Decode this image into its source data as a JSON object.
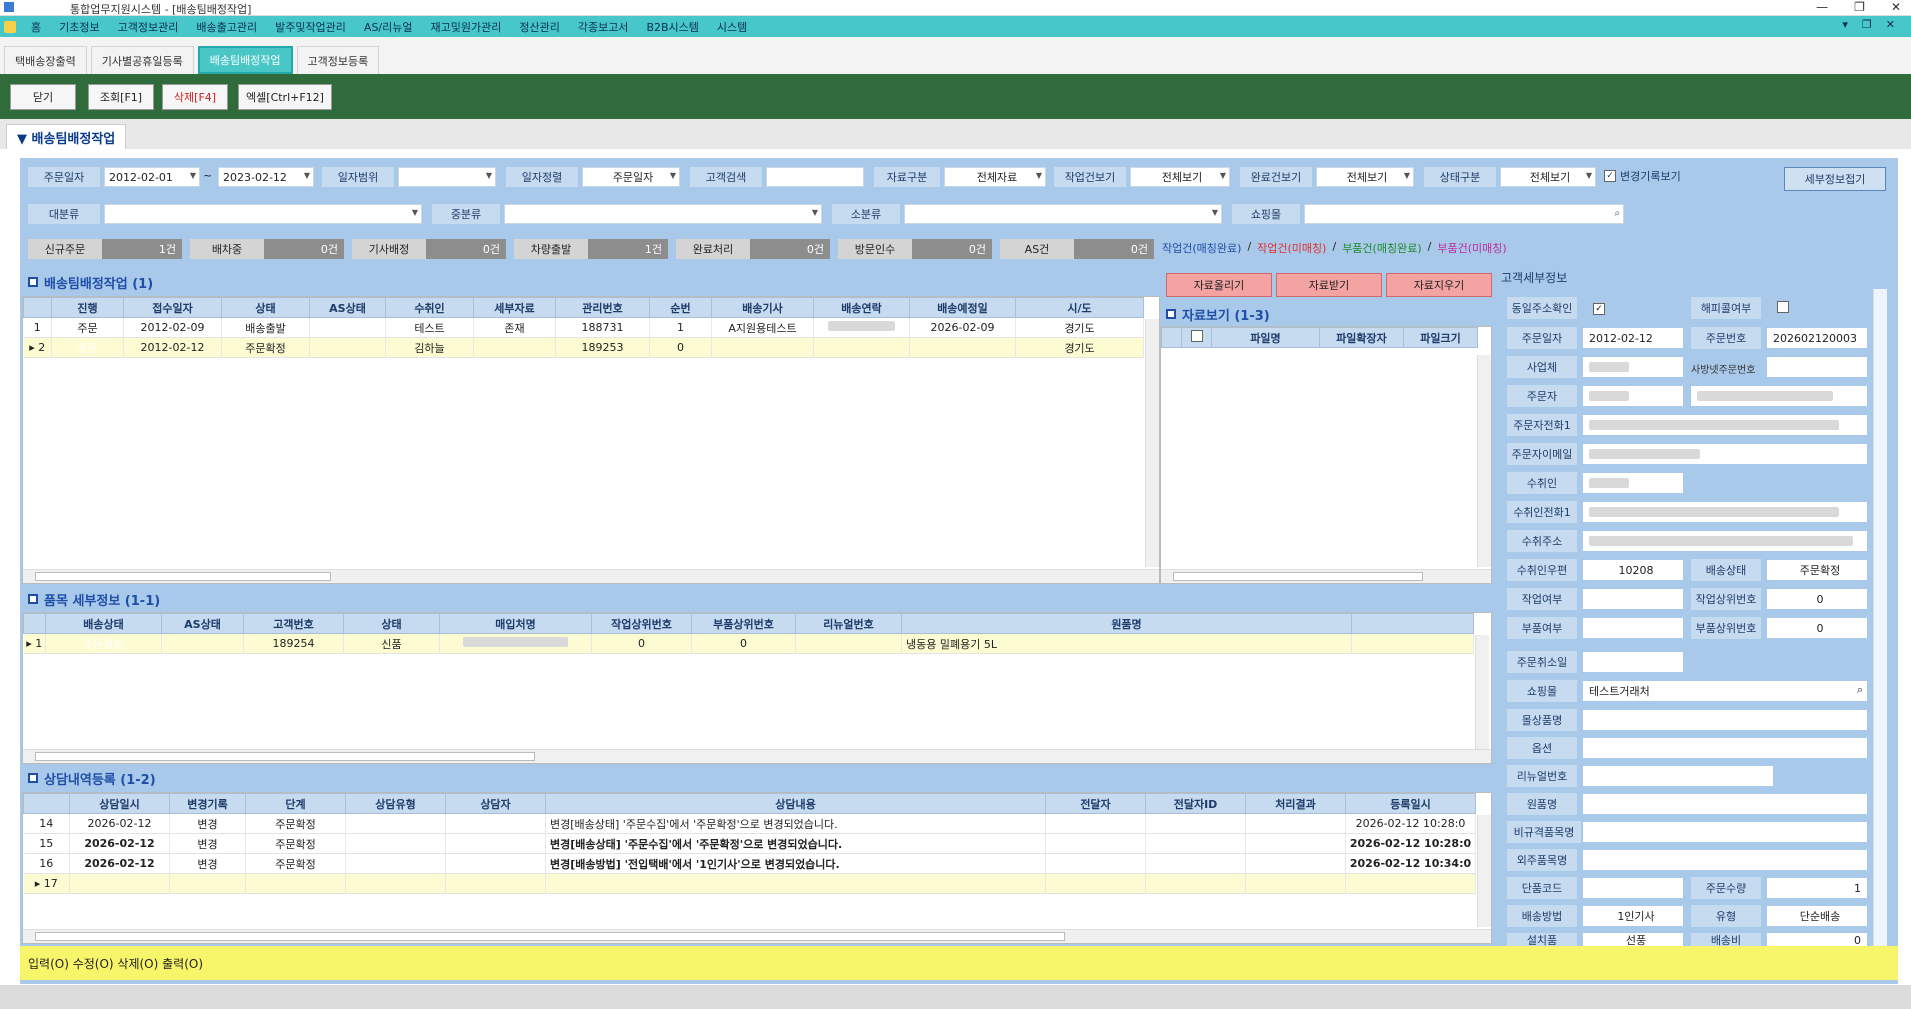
{
  "window": {
    "title": "통합업무지원시스템 - [배송팀배정작업]",
    "controls": [
      "—",
      "❐",
      "✕"
    ]
  },
  "menu": {
    "items": [
      "홈",
      "기초정보",
      "고객정보관리",
      "배송출고관리",
      "발주및작업관리",
      "AS/리뉴얼",
      "재고및원가관리",
      "정산관리",
      "각종보고서",
      "B2B시스템",
      "시스템"
    ],
    "right_controls": [
      "▾",
      "❐",
      "✕"
    ]
  },
  "tabs": [
    "택배송장출력",
    "기사별공휴일등록",
    "배송팀배정작업",
    "고객정보등록"
  ],
  "toolbar": {
    "close": "닫기",
    "query": "조회[F1]",
    "delete": "삭제[F4]",
    "excel": "엑셀[Ctrl+F12]"
  },
  "page_title": "▼ 배송팀배정작업",
  "filters": {
    "order_date_label": "주문일자",
    "date_from": "2012-02-01",
    "tilde": "~",
    "date_to": "2023-02-12",
    "date_range_label": "일자범위",
    "date_range_value": "",
    "date_sort_label": "일자정렬",
    "date_sort_value": "주문일자",
    "customer_search_label": "고객검색",
    "customer_search_value": "",
    "data_class_label": "자료구분",
    "data_class_value": "전체자료",
    "work_view_label": "작업건보기",
    "work_view_value": "전체보기",
    "done_view_label": "완료건보기",
    "done_view_value": "전체보기",
    "status_class_label": "상태구분",
    "status_class_value": "전체보기",
    "change_log_label": "변경기록보기",
    "detail_fold": "세부정보접기",
    "big_class_label": "대분류",
    "mid_class_label": "중분류",
    "small_class_label": "소분류",
    "mall_label": "쇼핑몰"
  },
  "counts": [
    {
      "label": "신규주문",
      "value": "1건"
    },
    {
      "label": "배차중",
      "value": "0건"
    },
    {
      "label": "기사배정",
      "value": "0건"
    },
    {
      "label": "차량출발",
      "value": "1건"
    },
    {
      "label": "완료처리",
      "value": "0건"
    },
    {
      "label": "방문인수",
      "value": "0건"
    },
    {
      "label": "AS건",
      "value": "0건"
    }
  ],
  "legend": {
    "a": "작업건(매칭완료)",
    "b": "작업건(미매칭)",
    "c": "부품건(매칭완료)",
    "d": "부품건(미매칭)",
    "sep": "/"
  },
  "assign": {
    "title": "배송팀배정작업 (1)",
    "columns": [
      "",
      "진행",
      "접수일자",
      "상태",
      "AS상태",
      "수취인",
      "세부자료",
      "관리번호",
      "순번",
      "배송기사",
      "배송연락",
      "배송예정일",
      "시/도"
    ],
    "rows": [
      [
        "1",
        "주문",
        "2012-02-09",
        "배송출발",
        "",
        "테스트",
        "존재",
        "188731",
        "1",
        "A지원용테스트",
        "",
        "2026-02-09",
        "경기도"
      ],
      [
        "▸ 2",
        "주문",
        "2012-02-12",
        "주문확정",
        "",
        "김하늘",
        "",
        "189253",
        "0",
        "",
        "",
        "",
        "경기도"
      ]
    ]
  },
  "files": {
    "upload": "자료올리기",
    "download": "자료받기",
    "remove": "자료지우기",
    "title": "자료보기 (1-3)",
    "columns": [
      "",
      "파일명",
      "파일확장자",
      "파일크기"
    ]
  },
  "items": {
    "title": "품목 세부정보 (1-1)",
    "columns": [
      "",
      "배송상태",
      "AS상태",
      "고객번호",
      "상태",
      "매입처명",
      "작업상위번호",
      "부품상위번호",
      "리뉴얼번호",
      "원품명"
    ],
    "rows": [
      [
        "▸ 1",
        "주문확정",
        "",
        "189254",
        "신품",
        "",
        "0",
        "0",
        "",
        "냉동용 밀폐용기 5L"
      ]
    ]
  },
  "consult": {
    "title": "상담내역등록 (1-2)",
    "columns": [
      "",
      "상담일시",
      "변경기록",
      "단계",
      "상담유형",
      "상담자",
      "상담내용",
      "전달자",
      "전달자ID",
      "처리결과",
      "등록일시"
    ],
    "rows": [
      [
        "14",
        "2026-02-12",
        "변경",
        "주문확정",
        "",
        "",
        "변경[배송상태] '주문수집'에서 '주문확정'으로 변경되었습니다.",
        "",
        "",
        "",
        "2026-02-12 10:28:0"
      ],
      [
        "15",
        "2026-02-12",
        "변경",
        "주문확정",
        "",
        "",
        "변경[배송상태] '주문수집'에서 '주문확정'으로 변경되었습니다.",
        "",
        "",
        "",
        "2026-02-12 10:28:0"
      ],
      [
        "16",
        "2026-02-12",
        "변경",
        "주문확정",
        "",
        "",
        "변경[배송방법] '전입택배'에서 '1인기사'으로 변경되었습니다.",
        "",
        "",
        "",
        "2026-02-12 10:34:0"
      ],
      [
        "▸ 17",
        "",
        "",
        "",
        "",
        "",
        "",
        "",
        "",
        "",
        ""
      ]
    ]
  },
  "detail": {
    "title": "고객세부정보",
    "same_addr": "동일주소확인",
    "same_addr_check": "✓",
    "photo": "해피콜여부",
    "order_date_label": "주문일자",
    "order_date": "2012-02-12",
    "order_no_label": "주문번호",
    "order_no": "202602120003",
    "biz_label": "사업체",
    "biz_hint": "사방넷주문번호",
    "orderer_label": "주문자",
    "orderer_phone_label": "주문자전화1",
    "orderer_email_label": "주문자이메일",
    "receiver_label": "수취인",
    "receiver_phone_label": "수취인전화1",
    "receiver_addr_label": "수취주소",
    "zip_label": "수취인우편",
    "zip": "10208",
    "ship_status_label": "배송상태",
    "ship_status": "주문확정",
    "work_label": "작업여부",
    "work_parent_label": "작업상위번호",
    "work_parent": "0",
    "part_label": "부품여부",
    "part_parent_label": "부품상위번호",
    "part_parent": "0",
    "cancel_label": "주문취소일",
    "mall_label": "쇼핑몰",
    "mall": "테스트거래처",
    "mall_product_label": "몰상품명",
    "option_label": "옵션",
    "renewal_label": "리뉴얼번호",
    "product_label": "원품명",
    "nonstd_label": "비규격품목명",
    "outsource_label": "외주품목명",
    "unit_code_label": "단품코드",
    "qty_label": "주문수량",
    "qty": "1",
    "ship_method_label": "배송방법",
    "ship_method": "1인기사",
    "type_label": "유형",
    "type": "단순배송",
    "extra_label": "설치품",
    "extra_value": "선풍",
    "fee_label": "배송비",
    "fee": "0"
  },
  "status_bar": "입력(O) 수정(O) 삭제(O) 출력(O)"
}
